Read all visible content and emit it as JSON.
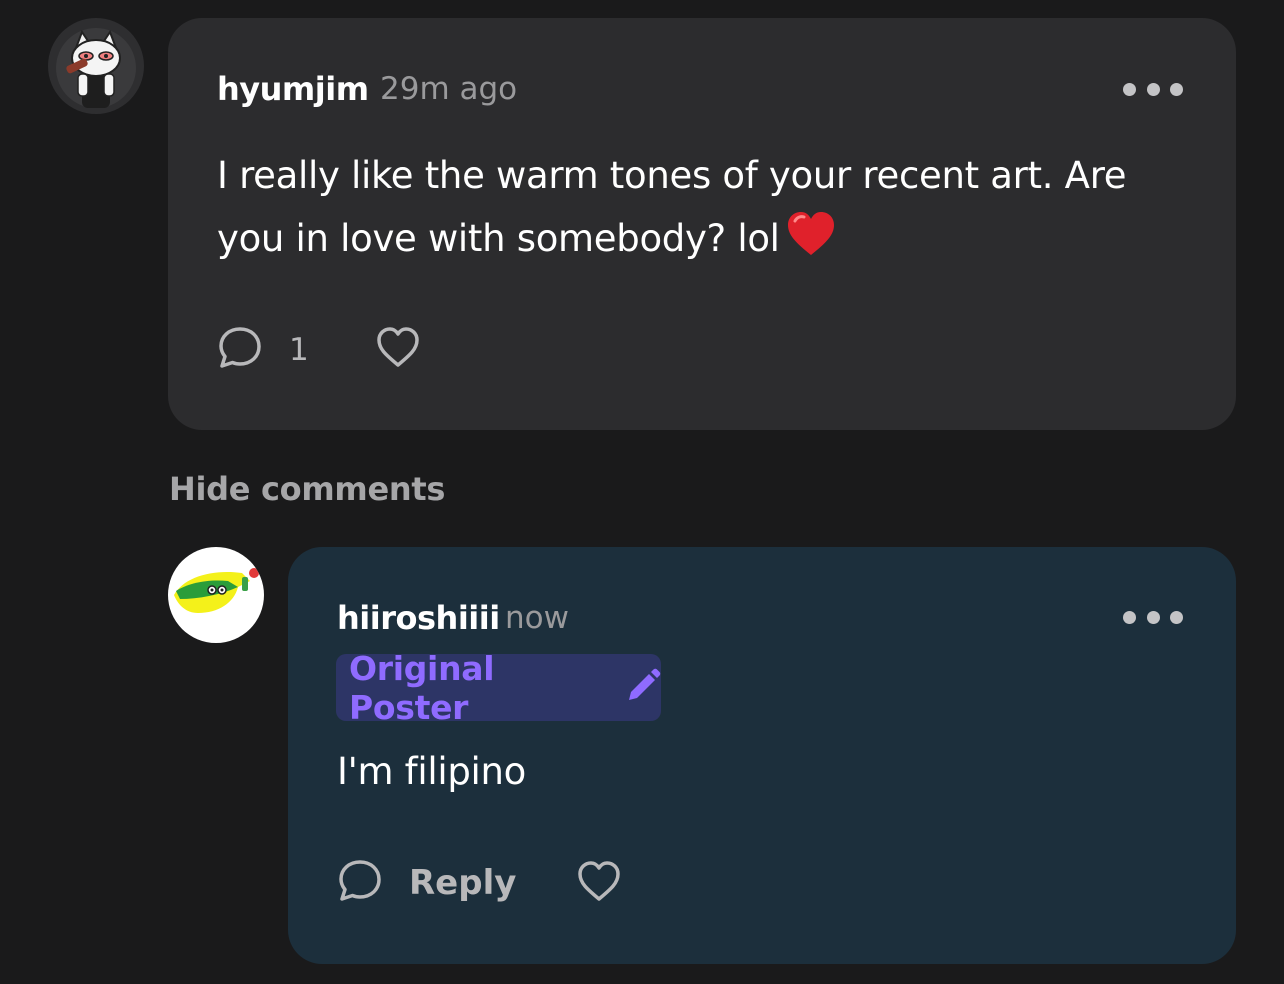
{
  "comment": {
    "username": "hyumjim",
    "timestamp": "29m ago",
    "text_line1": "I really like the warm tones of your recent art. Are",
    "text_line2": "you in love with somebody? lol",
    "emoji": "❤️",
    "reply_count": "1",
    "icons": {
      "avatar": "cat-avatar",
      "more": "more-dots-icon",
      "comment": "comment-bubble-icon",
      "like": "heart-outline-icon"
    }
  },
  "hide_comments_label": "Hide comments",
  "reply": {
    "username": "hiiroshiiii",
    "timestamp": "now",
    "badge_label": "Original Poster",
    "badge_icon": "pencil-icon",
    "text": "I'm filipino",
    "reply_label": "Reply",
    "icons": {
      "avatar": "green-creature-avatar",
      "more": "more-dots-icon",
      "comment": "comment-bubble-icon",
      "like": "heart-outline-icon"
    }
  },
  "colors": {
    "background": "#1a1a1b",
    "comment_card": "#2c2c2e",
    "reply_card": "#1c2f3c",
    "badge_bg": "#2d3566",
    "badge_text": "#8f6bff"
  }
}
